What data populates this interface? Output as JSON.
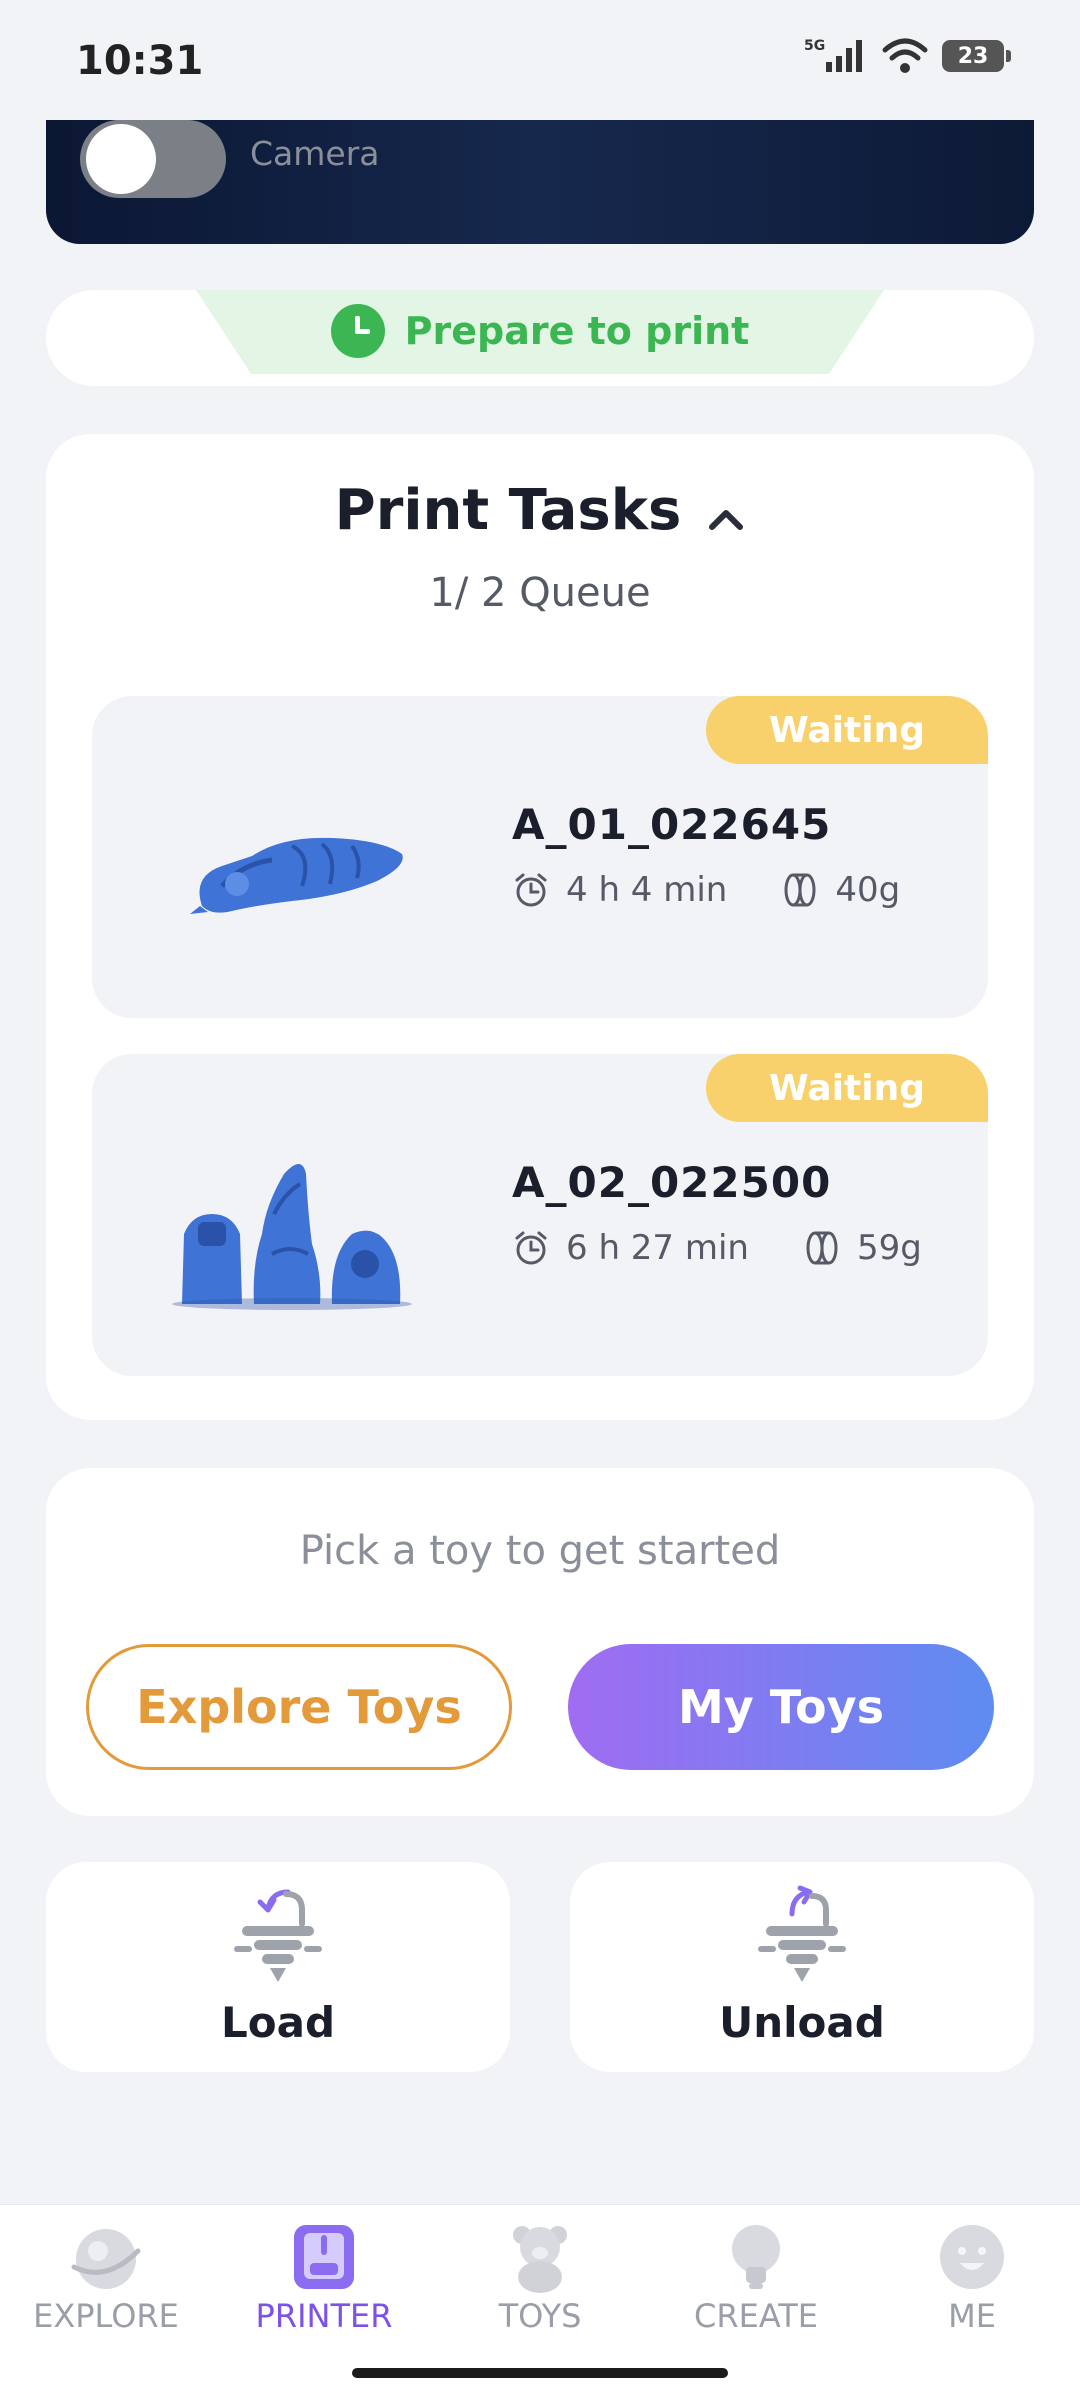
{
  "status_bar": {
    "time": "10:31",
    "network": "5G",
    "battery": "23"
  },
  "camera": {
    "label": "Camera",
    "toggle_on": false
  },
  "prepare": {
    "text": "Prepare to print",
    "color": "#3cb653"
  },
  "print_tasks": {
    "title": "Print Tasks",
    "queue": "1/ 2 Queue",
    "items": [
      {
        "status": "Waiting",
        "name": "A_01_022645",
        "time": "4 h 4 min",
        "filament": "40g",
        "thumbnail": "blue-dragon-model"
      },
      {
        "status": "Waiting",
        "name": "A_02_022500",
        "time": "6 h 27 min",
        "filament": "59g",
        "thumbnail": "blue-figurines-model"
      }
    ]
  },
  "pick": {
    "prompt": "Pick a toy to get started",
    "explore_label": "Explore Toys",
    "mytoys_label": "My Toys"
  },
  "actions": {
    "load_label": "Load",
    "unload_label": "Unload"
  },
  "nav": {
    "items": [
      {
        "label": "EXPLORE",
        "icon": "planet-icon",
        "active": false
      },
      {
        "label": "PRINTER",
        "icon": "printer-icon",
        "active": true
      },
      {
        "label": "TOYS",
        "icon": "bear-icon",
        "active": false
      },
      {
        "label": "CREATE",
        "icon": "lightbulb-icon",
        "active": false
      },
      {
        "label": "ME",
        "icon": "face-icon",
        "active": false
      }
    ]
  },
  "colors": {
    "accent": "#7d52e6",
    "waiting_badge": "#f8d06c",
    "explore_orange": "#e39a3a",
    "model_blue": "#3f73d6"
  }
}
